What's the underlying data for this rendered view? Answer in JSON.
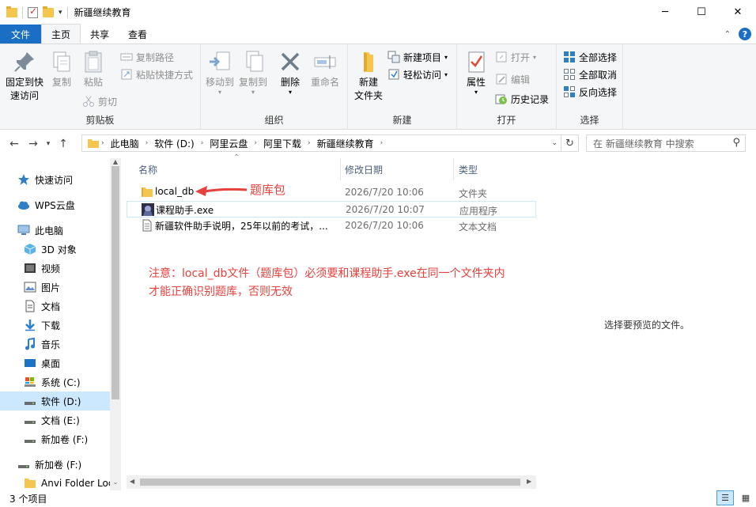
{
  "window": {
    "title": "新疆继续教育",
    "minimize": "─",
    "maximize": "☐",
    "close": "✕"
  },
  "tabs": [
    {
      "label": "文件"
    },
    {
      "label": "主页"
    },
    {
      "label": "共享"
    },
    {
      "label": "查看"
    }
  ],
  "ribbon": {
    "clipboard": {
      "label": "剪贴板",
      "pin": "固定到快\n速访问",
      "pin_l1": "固定到快",
      "pin_l2": "速访问",
      "copy": "复制",
      "paste": "粘贴",
      "copy_path": "复制路径",
      "paste_shortcut": "粘贴快捷方式",
      "cut": "剪切"
    },
    "organize": {
      "label": "组织",
      "move_to": "移动到",
      "copy_to": "复制到",
      "delete": "删除",
      "rename": "重命名"
    },
    "new": {
      "label": "新建",
      "new_folder_l1": "新建",
      "new_folder_l2": "文件夹",
      "new_item": "新建项目",
      "easy_access": "轻松访问"
    },
    "open": {
      "label": "打开",
      "properties": "属性",
      "open": "打开",
      "edit": "编辑",
      "history": "历史记录"
    },
    "select": {
      "label": "选择",
      "select_all": "全部选择",
      "select_none": "全部取消",
      "invert": "反向选择"
    }
  },
  "address": {
    "crumbs": [
      "此电脑",
      "软件 (D:)",
      "阿里云盘",
      "阿里下载",
      "新疆继续教育"
    ]
  },
  "search": {
    "placeholder": "在 新疆继续教育 中搜索"
  },
  "navpane": {
    "items": [
      {
        "label": "快速访问",
        "icon": "star-icon"
      },
      {
        "label": "WPS云盘",
        "icon": "cloud-icon"
      },
      {
        "label": "此电脑",
        "icon": "computer-icon"
      },
      {
        "label": "3D 对象",
        "icon": "cube-icon"
      },
      {
        "label": "视频",
        "icon": "video-icon"
      },
      {
        "label": "图片",
        "icon": "picture-icon"
      },
      {
        "label": "文档",
        "icon": "document-icon"
      },
      {
        "label": "下载",
        "icon": "download-icon"
      },
      {
        "label": "音乐",
        "icon": "music-icon"
      },
      {
        "label": "桌面",
        "icon": "desktop-icon"
      },
      {
        "label": "系统 (C:)",
        "icon": "drive-c-icon"
      },
      {
        "label": "软件 (D:)",
        "icon": "drive-icon"
      },
      {
        "label": "文档 (E:)",
        "icon": "drive-icon"
      },
      {
        "label": "新加卷 (F:)",
        "icon": "drive-icon"
      },
      {
        "label": "新加卷 (F:)",
        "icon": "drive-icon"
      },
      {
        "label": "Anvi Folder Loc",
        "icon": "folder-icon"
      }
    ]
  },
  "filelist": {
    "columns": {
      "name": "名称",
      "date": "修改日期",
      "type": "类型"
    },
    "rows": [
      {
        "name": "local_db",
        "date": "2026/7/20 10:06",
        "type": "文件夹",
        "icon": "folder-icon"
      },
      {
        "name": "课程助手.exe",
        "date": "2026/7/20 10:07",
        "type": "应用程序",
        "icon": "app-icon"
      },
      {
        "name": "新疆软件助手说明，25年以前的考试，...",
        "date": "2026/7/20 10:06",
        "type": "文本文档",
        "icon": "text-file-icon"
      }
    ]
  },
  "annotations": {
    "arrow_label": "题库包",
    "note_line1": "注意：local_db文件（题库包）必须要和课程助手.exe在同一个文件夹内",
    "note_line2": "才能正确识别题库，否则无效"
  },
  "preview": {
    "empty_text": "选择要预览的文件。"
  },
  "status": {
    "count": "3 个项目"
  },
  "colors": {
    "accent": "#1a6fc4",
    "selection": "#cce8ff",
    "annotation": "#e8403c"
  }
}
